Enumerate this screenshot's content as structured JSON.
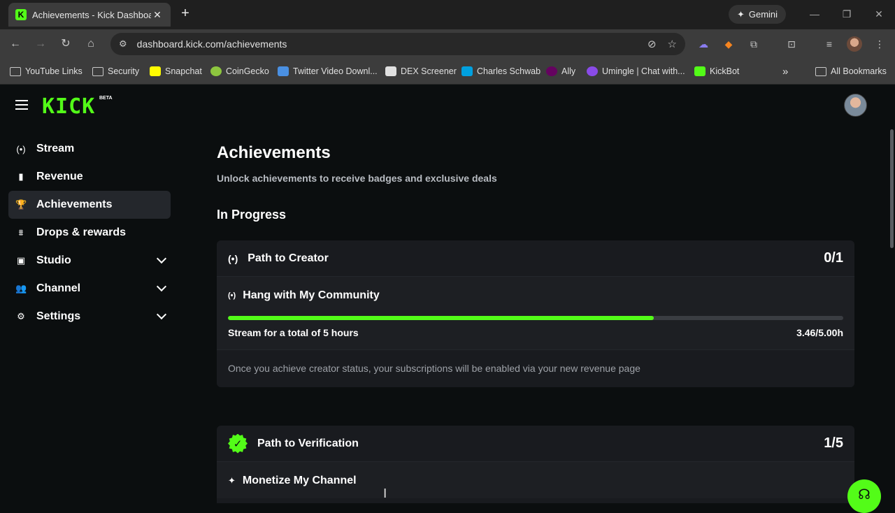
{
  "browser": {
    "tab_title": "Achievements - Kick Dashboard",
    "tab_favicon": "K",
    "gemini_label": "Gemini",
    "url": "dashboard.kick.com/achievements",
    "bookmarks": [
      {
        "label": "YouTube Links",
        "icon": "folder-icon"
      },
      {
        "label": "Security",
        "icon": "folder-icon"
      },
      {
        "label": "Snapchat",
        "icon": "snapchat-icon",
        "color": "#fffc00"
      },
      {
        "label": "CoinGecko",
        "icon": "coingecko-icon",
        "color": "#8dc63f"
      },
      {
        "label": "Twitter Video Downl...",
        "icon": "twitter-video-icon",
        "color": "#4a90e2"
      },
      {
        "label": "DEX Screener",
        "icon": "dexscreener-icon",
        "color": "#e0e0e0"
      },
      {
        "label": "Charles Schwab",
        "icon": "schwab-icon",
        "color": "#00a0df"
      },
      {
        "label": "Ally",
        "icon": "ally-icon",
        "color": "#650360"
      },
      {
        "label": "Umingle | Chat with...",
        "icon": "umingle-icon",
        "color": "#8a4be8"
      },
      {
        "label": "KickBot",
        "icon": "kickbot-icon",
        "color": "#53fc18"
      }
    ],
    "all_bookmarks": "All Bookmarks"
  },
  "app": {
    "logo": "KICK",
    "logo_badge": "BETA",
    "accent": "#53fc18"
  },
  "sidebar": {
    "items": [
      {
        "label": "Stream",
        "icon": "stream-icon",
        "glyph": "(•)"
      },
      {
        "label": "Revenue",
        "icon": "revenue-icon",
        "glyph": "▮"
      },
      {
        "label": "Achievements",
        "icon": "trophy-icon",
        "glyph": "🏆"
      },
      {
        "label": "Drops & rewards",
        "icon": "drops-icon",
        "glyph": "⩩"
      },
      {
        "label": "Studio",
        "icon": "studio-icon",
        "glyph": "▣"
      },
      {
        "label": "Channel",
        "icon": "channel-icon",
        "glyph": "👥"
      },
      {
        "label": "Settings",
        "icon": "gear-icon",
        "glyph": "⚙"
      }
    ]
  },
  "main": {
    "title": "Achievements",
    "subtitle": "Unlock achievements to receive badges and exclusive deals",
    "section_title": "In Progress",
    "cards": [
      {
        "title": "Path to Creator",
        "count": "0/1",
        "task_title": "Hang with My Community",
        "task_desc": "Stream for a total of 5 hours",
        "task_progress_text": "3.46/5.00h",
        "task_progress_fraction": 0.692,
        "footer": "Once you achieve creator status, your subscriptions will be enabled via your new revenue page"
      },
      {
        "title": "Path to Verification",
        "count": "1/5",
        "task_title": "Monetize My Channel"
      }
    ]
  }
}
